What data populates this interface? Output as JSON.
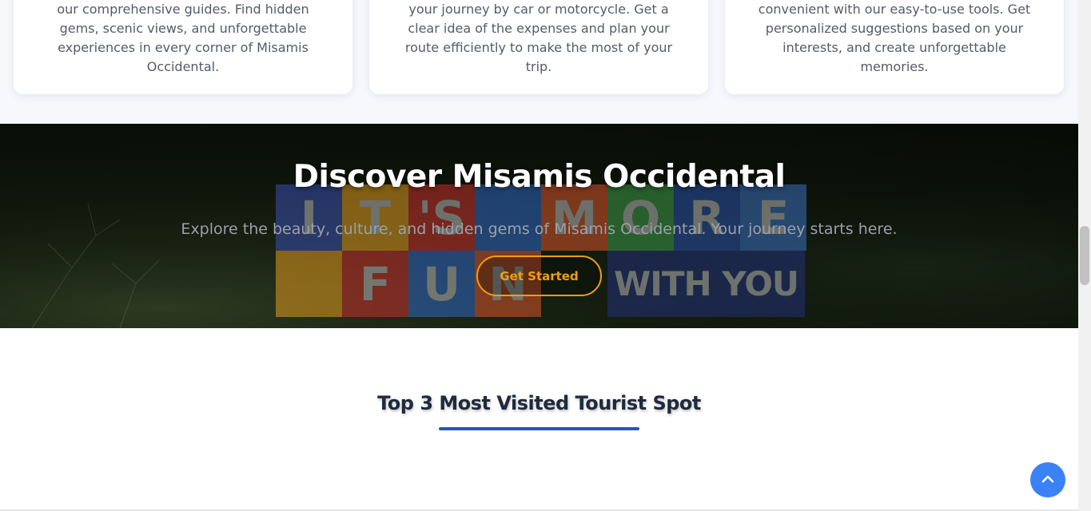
{
  "cards": [
    {
      "text": "our comprehensive guides. Find hidden gems, scenic views, and unforgettable experiences in every corner of Misamis Occidental."
    },
    {
      "text": "your journey by car or motorcycle. Get a clear idea of the expenses and plan your route efficiently to make the most of your trip."
    },
    {
      "text": "convenient with our easy-to-use tools. Get personalized suggestions based on your interests, and create unforgettable memories."
    }
  ],
  "hero": {
    "title": "Discover Misamis Occidental",
    "subtitle": "Explore the beauty, culture, and hidden gems of Misamis Occidental. Your journey starts here.",
    "button_label": "Get Started",
    "logo": {
      "row1": [
        "I",
        "T",
        "'S",
        "",
        "M",
        "O",
        "R",
        "E"
      ],
      "row2": [
        "",
        "F",
        "U",
        "N"
      ],
      "tagline": "WITH YOU",
      "colors": [
        "#3a4fb0",
        "#e09a1f",
        "#c9302c",
        "#2f66c4",
        "#d9542a",
        "#3d9b49",
        "#2a4fa8",
        "#3b6fc1"
      ]
    }
  },
  "spots": {
    "title": "Top 3 Most Visited Tourist Spot"
  },
  "colors": {
    "accent_orange": "#f39c12",
    "accent_blue": "#2256c4",
    "back_to_top": "#3b82f6"
  },
  "icons": {
    "back_to_top": "chevron-up-icon"
  }
}
